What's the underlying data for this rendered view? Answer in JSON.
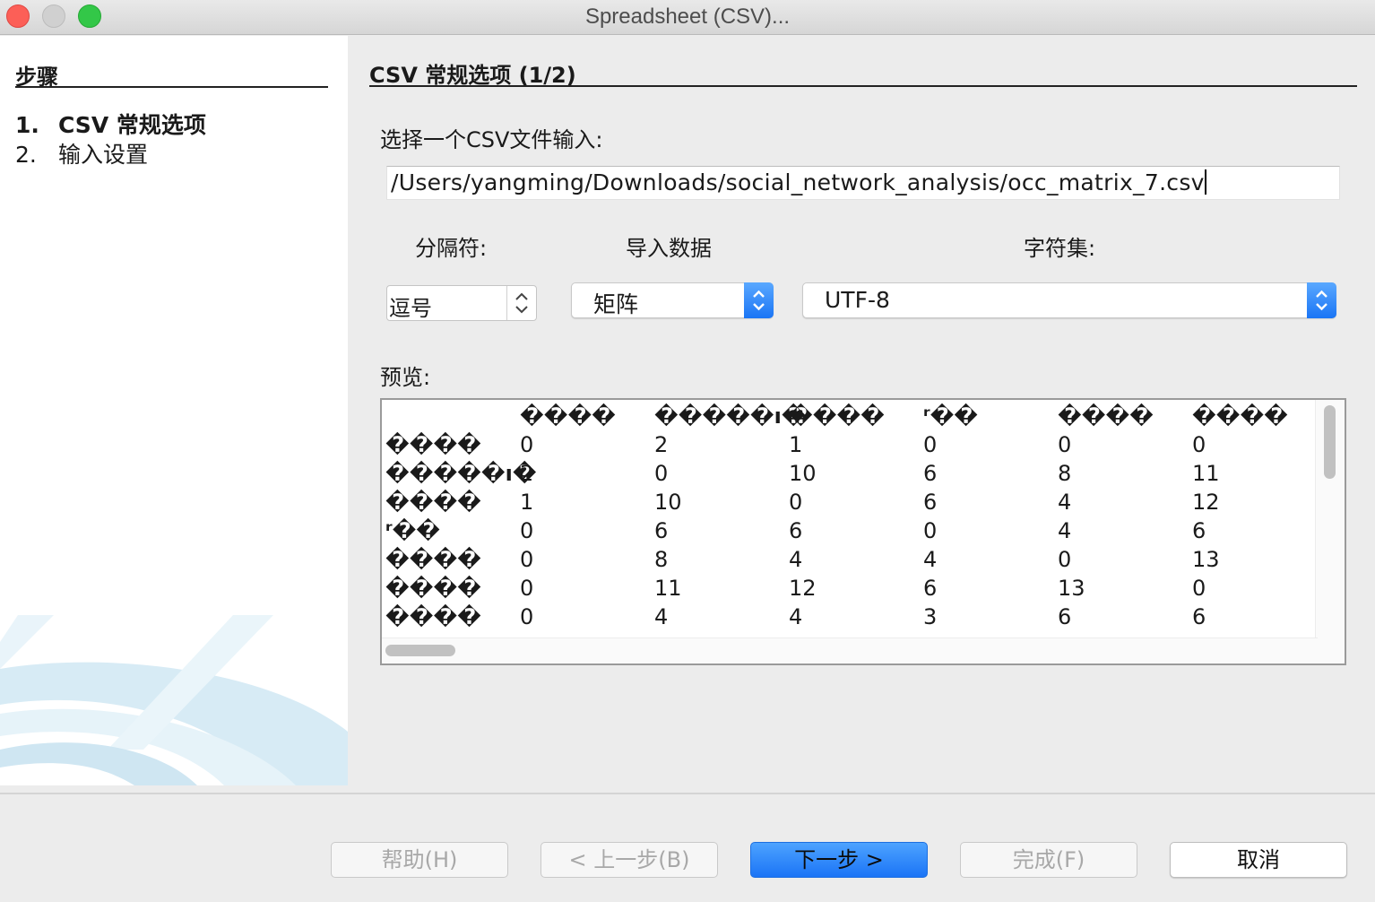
{
  "window": {
    "title": "Spreadsheet (CSV)..."
  },
  "steps": {
    "heading": "步骤",
    "items": [
      {
        "num": "1.",
        "label": "CSV 常规选项"
      },
      {
        "num": "2.",
        "label": "输入设置"
      }
    ]
  },
  "section": {
    "title": "CSV 常规选项 (1/2)"
  },
  "file": {
    "label": "选择一个CSV文件输入:",
    "value": "/Users/yangming/Downloads/social_network_analysis/occ_matrix_7.csv"
  },
  "options": {
    "separator_label": "分隔符:",
    "separator_value": "逗号",
    "import_label": "导入数据",
    "import_value": "矩阵",
    "charset_label": "字符集:",
    "charset_value": "UTF-8"
  },
  "preview": {
    "label": "预览:",
    "header": [
      "",
      "����",
      "�����ı�",
      "����",
      "ʳ��",
      "����",
      "����"
    ],
    "rows": [
      [
        "����",
        "0",
        "2",
        "1",
        "0",
        "0",
        "0"
      ],
      [
        "�����ı�",
        "2",
        "0",
        "10",
        "6",
        "8",
        "11"
      ],
      [
        "����",
        "1",
        "10",
        "0",
        "6",
        "4",
        "12"
      ],
      [
        "ʳ��",
        "0",
        "6",
        "6",
        "0",
        "4",
        "6"
      ],
      [
        "����",
        "0",
        "8",
        "4",
        "4",
        "0",
        "13"
      ],
      [
        "����",
        "0",
        "11",
        "12",
        "6",
        "13",
        "0"
      ],
      [
        "����",
        "0",
        "4",
        "4",
        "3",
        "6",
        "6"
      ]
    ]
  },
  "buttons": {
    "help": "帮助(H)",
    "prev": "< 上一步(B)",
    "next": "下一步 >",
    "finish": "完成(F)",
    "cancel": "取消"
  },
  "colors": {
    "accent": "#1b74f6",
    "close": "#fc5f57",
    "maximize": "#33c748"
  },
  "icons": [
    "updown-chevron-icon"
  ]
}
